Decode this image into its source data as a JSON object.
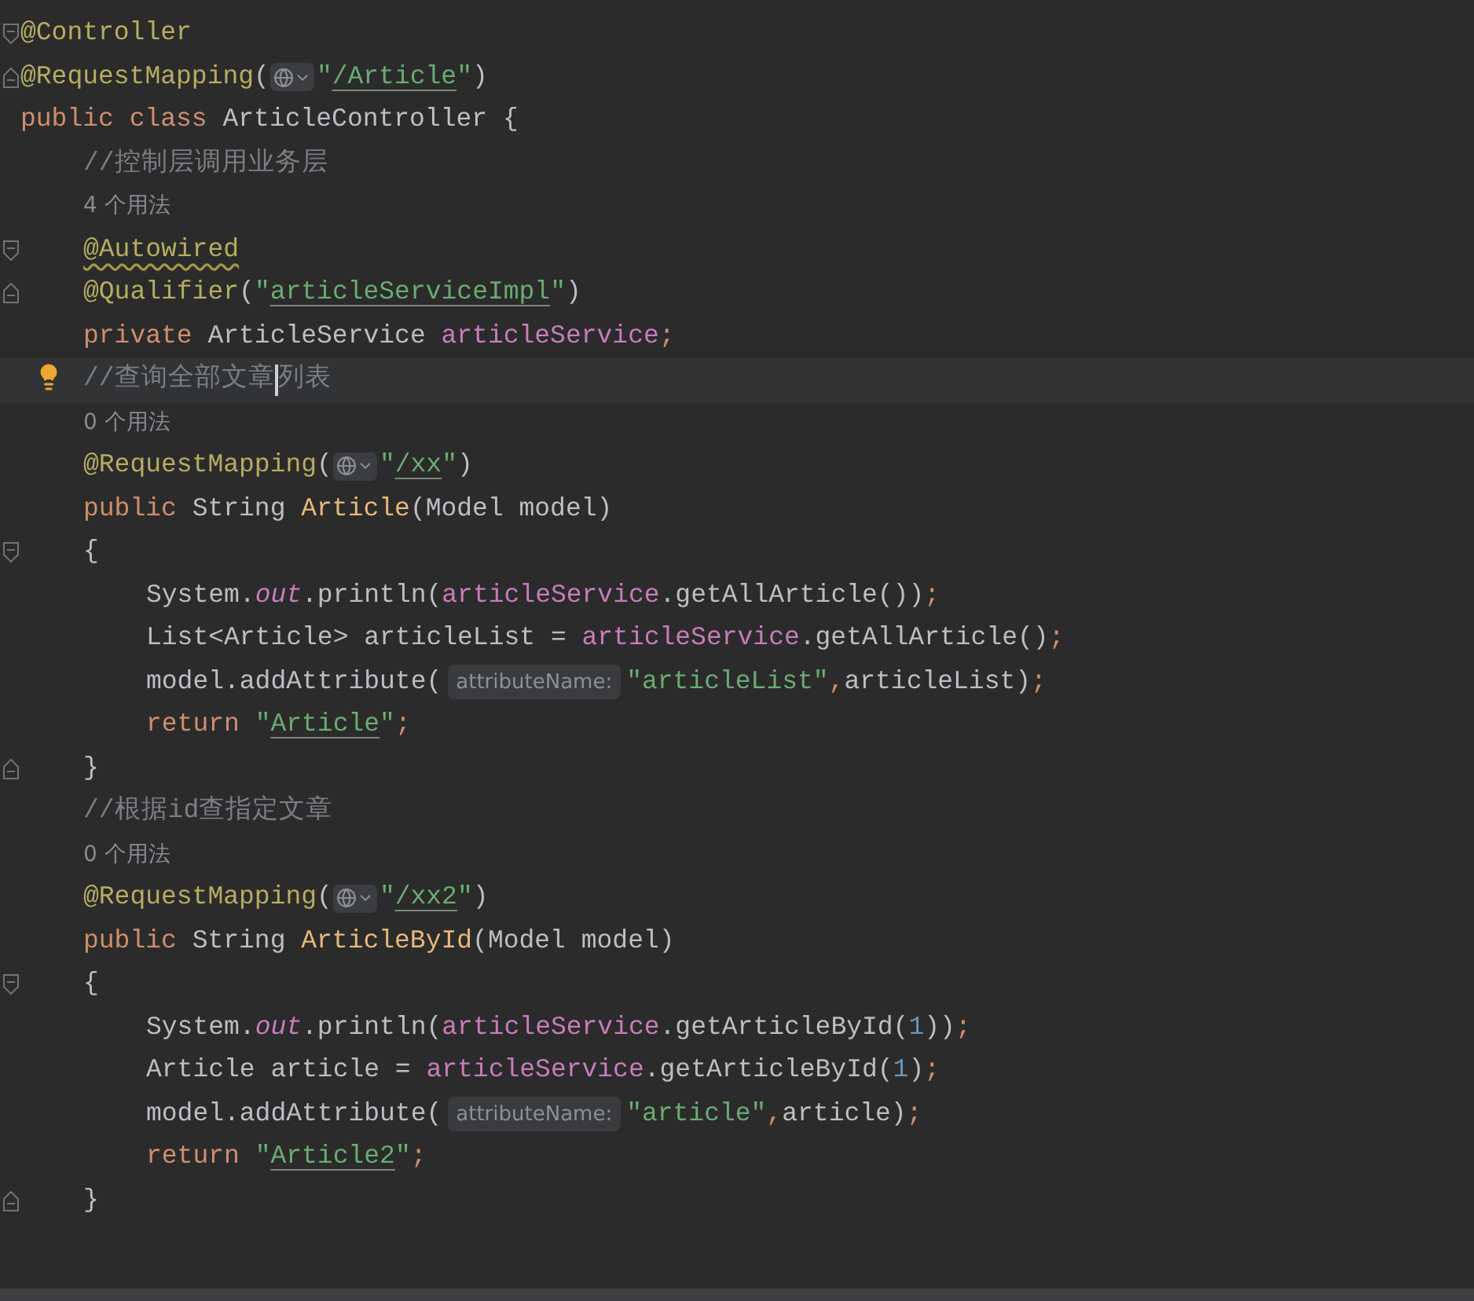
{
  "lines": [
    {
      "fold_start": true,
      "tokens": [
        {
          "kind": "annotation",
          "text": "@Controller"
        }
      ]
    },
    {
      "fold_end": true,
      "tokens": [
        {
          "kind": "annotation",
          "text": "@RequestMapping"
        },
        {
          "kind": "plain",
          "text": "("
        },
        {
          "kind": "globe"
        },
        {
          "kind": "string",
          "text": "\""
        },
        {
          "kind": "url",
          "text": "/Article"
        },
        {
          "kind": "string",
          "text": "\""
        },
        {
          "kind": "plain",
          "text": ")"
        }
      ]
    },
    {
      "tokens": [
        {
          "kind": "keyword",
          "text": "public "
        },
        {
          "kind": "keyword",
          "text": "class "
        },
        {
          "kind": "plain",
          "text": "ArticleController {"
        }
      ],
      "children": [
        {
          "tokens": [
            {
              "kind": "comment",
              "text": "//控制层调用业务层"
            }
          ]
        },
        {
          "tokens": [
            {
              "kind": "usage",
              "text": "4 个用法"
            }
          ]
        },
        {
          "fold_start": true,
          "tokens": [
            {
              "kind": "annotation",
              "text": "@Autowired",
              "warning": true
            }
          ]
        },
        {
          "fold_end": true,
          "tokens": [
            {
              "kind": "annotation",
              "text": "@Qualifier"
            },
            {
              "kind": "plain",
              "text": "("
            },
            {
              "kind": "string",
              "text": "\""
            },
            {
              "kind": "url",
              "text": "articleServiceImpl"
            },
            {
              "kind": "string",
              "text": "\""
            },
            {
              "kind": "plain",
              "text": ")"
            }
          ]
        },
        {
          "tokens": [
            {
              "kind": "keyword",
              "text": "private "
            },
            {
              "kind": "plain",
              "text": "ArticleService "
            },
            {
              "kind": "field",
              "text": "articleService"
            },
            {
              "kind": "punct",
              "text": ";"
            }
          ]
        },
        {
          "current": true,
          "bulb": true,
          "tokens": [
            {
              "kind": "comment",
              "text": "//查询全部文章"
            },
            {
              "kind": "caret"
            },
            {
              "kind": "comment",
              "text": "列表"
            }
          ]
        },
        {
          "tokens": [
            {
              "kind": "usage",
              "text": "0 个用法"
            }
          ]
        },
        {
          "tokens": [
            {
              "kind": "annotation",
              "text": "@RequestMapping"
            },
            {
              "kind": "plain",
              "text": "("
            },
            {
              "kind": "globe"
            },
            {
              "kind": "string",
              "text": "\""
            },
            {
              "kind": "url",
              "text": "/xx"
            },
            {
              "kind": "string",
              "text": "\""
            },
            {
              "kind": "plain",
              "text": ")"
            }
          ]
        },
        {
          "tokens": [
            {
              "kind": "keyword",
              "text": "public "
            },
            {
              "kind": "plain",
              "text": "String "
            },
            {
              "kind": "method",
              "text": "Article"
            },
            {
              "kind": "plain",
              "text": "(Model model)"
            }
          ]
        },
        {
          "fold_start": true,
          "tokens": [
            {
              "kind": "plain",
              "text": "{"
            }
          ],
          "children": [
            {
              "tokens": [
                {
                  "kind": "plain",
                  "text": "System."
                },
                {
                  "kind": "static",
                  "text": "out"
                },
                {
                  "kind": "plain",
                  "text": ".println("
                },
                {
                  "kind": "field",
                  "text": "articleService"
                },
                {
                  "kind": "plain",
                  "text": ".getAllArticle())"
                },
                {
                  "kind": "punct",
                  "text": ";"
                }
              ]
            },
            {
              "tokens": [
                {
                  "kind": "plain",
                  "text": "List<Article> articleList = "
                },
                {
                  "kind": "field",
                  "text": "articleService"
                },
                {
                  "kind": "plain",
                  "text": ".getAllArticle()"
                },
                {
                  "kind": "punct",
                  "text": ";"
                }
              ]
            },
            {
              "tokens": [
                {
                  "kind": "plain",
                  "text": "model.addAttribute("
                },
                {
                  "kind": "hint",
                  "text": "attributeName:"
                },
                {
                  "kind": "string",
                  "text": "\"articleList\""
                },
                {
                  "kind": "punct",
                  "text": ","
                },
                {
                  "kind": "plain",
                  "text": "articleList)"
                },
                {
                  "kind": "punct",
                  "text": ";"
                }
              ]
            },
            {
              "tokens": [
                {
                  "kind": "keyword",
                  "text": "return "
                },
                {
                  "kind": "string",
                  "text": "\""
                },
                {
                  "kind": "url",
                  "text": "Article"
                },
                {
                  "kind": "string",
                  "text": "\""
                },
                {
                  "kind": "punct",
                  "text": ";"
                }
              ]
            }
          ]
        },
        {
          "fold_end": true,
          "tokens": [
            {
              "kind": "plain",
              "text": "}"
            }
          ]
        },
        {
          "tokens": [
            {
              "kind": "comment",
              "text": "//根据id查指定文章"
            }
          ]
        },
        {
          "tokens": [
            {
              "kind": "usage",
              "text": "0 个用法"
            }
          ]
        },
        {
          "tokens": [
            {
              "kind": "annotation",
              "text": "@RequestMapping"
            },
            {
              "kind": "plain",
              "text": "("
            },
            {
              "kind": "globe"
            },
            {
              "kind": "string",
              "text": "\""
            },
            {
              "kind": "url",
              "text": "/xx2"
            },
            {
              "kind": "string",
              "text": "\""
            },
            {
              "kind": "plain",
              "text": ")"
            }
          ]
        },
        {
          "tokens": [
            {
              "kind": "keyword",
              "text": "public "
            },
            {
              "kind": "plain",
              "text": "String "
            },
            {
              "kind": "method",
              "text": "ArticleById"
            },
            {
              "kind": "plain",
              "text": "(Model model)"
            }
          ]
        },
        {
          "fold_start": true,
          "tokens": [
            {
              "kind": "plain",
              "text": "{"
            }
          ],
          "children": [
            {
              "tokens": [
                {
                  "kind": "plain",
                  "text": "System."
                },
                {
                  "kind": "static",
                  "text": "out"
                },
                {
                  "kind": "plain",
                  "text": ".println("
                },
                {
                  "kind": "field",
                  "text": "articleService"
                },
                {
                  "kind": "plain",
                  "text": ".getArticleById("
                },
                {
                  "kind": "number",
                  "text": "1"
                },
                {
                  "kind": "plain",
                  "text": "))"
                },
                {
                  "kind": "punct",
                  "text": ";"
                }
              ]
            },
            {
              "tokens": [
                {
                  "kind": "plain",
                  "text": "Article article = "
                },
                {
                  "kind": "field",
                  "text": "articleService"
                },
                {
                  "kind": "plain",
                  "text": ".getArticleById("
                },
                {
                  "kind": "number",
                  "text": "1"
                },
                {
                  "kind": "plain",
                  "text": ")"
                },
                {
                  "kind": "punct",
                  "text": ";"
                }
              ]
            },
            {
              "tokens": [
                {
                  "kind": "plain",
                  "text": "model.addAttribute("
                },
                {
                  "kind": "hint",
                  "text": "attributeName:"
                },
                {
                  "kind": "string",
                  "text": "\"article\""
                },
                {
                  "kind": "punct",
                  "text": ","
                },
                {
                  "kind": "plain",
                  "text": "article)"
                },
                {
                  "kind": "punct",
                  "text": ";"
                }
              ]
            },
            {
              "tokens": [
                {
                  "kind": "keyword",
                  "text": "return "
                },
                {
                  "kind": "string",
                  "text": "\""
                },
                {
                  "kind": "url",
                  "text": "Article2"
                },
                {
                  "kind": "string",
                  "text": "\""
                },
                {
                  "kind": "punct",
                  "text": ";"
                }
              ]
            }
          ]
        },
        {
          "fold_end": true,
          "tokens": [
            {
              "kind": "plain",
              "text": "}"
            }
          ]
        }
      ]
    }
  ]
}
